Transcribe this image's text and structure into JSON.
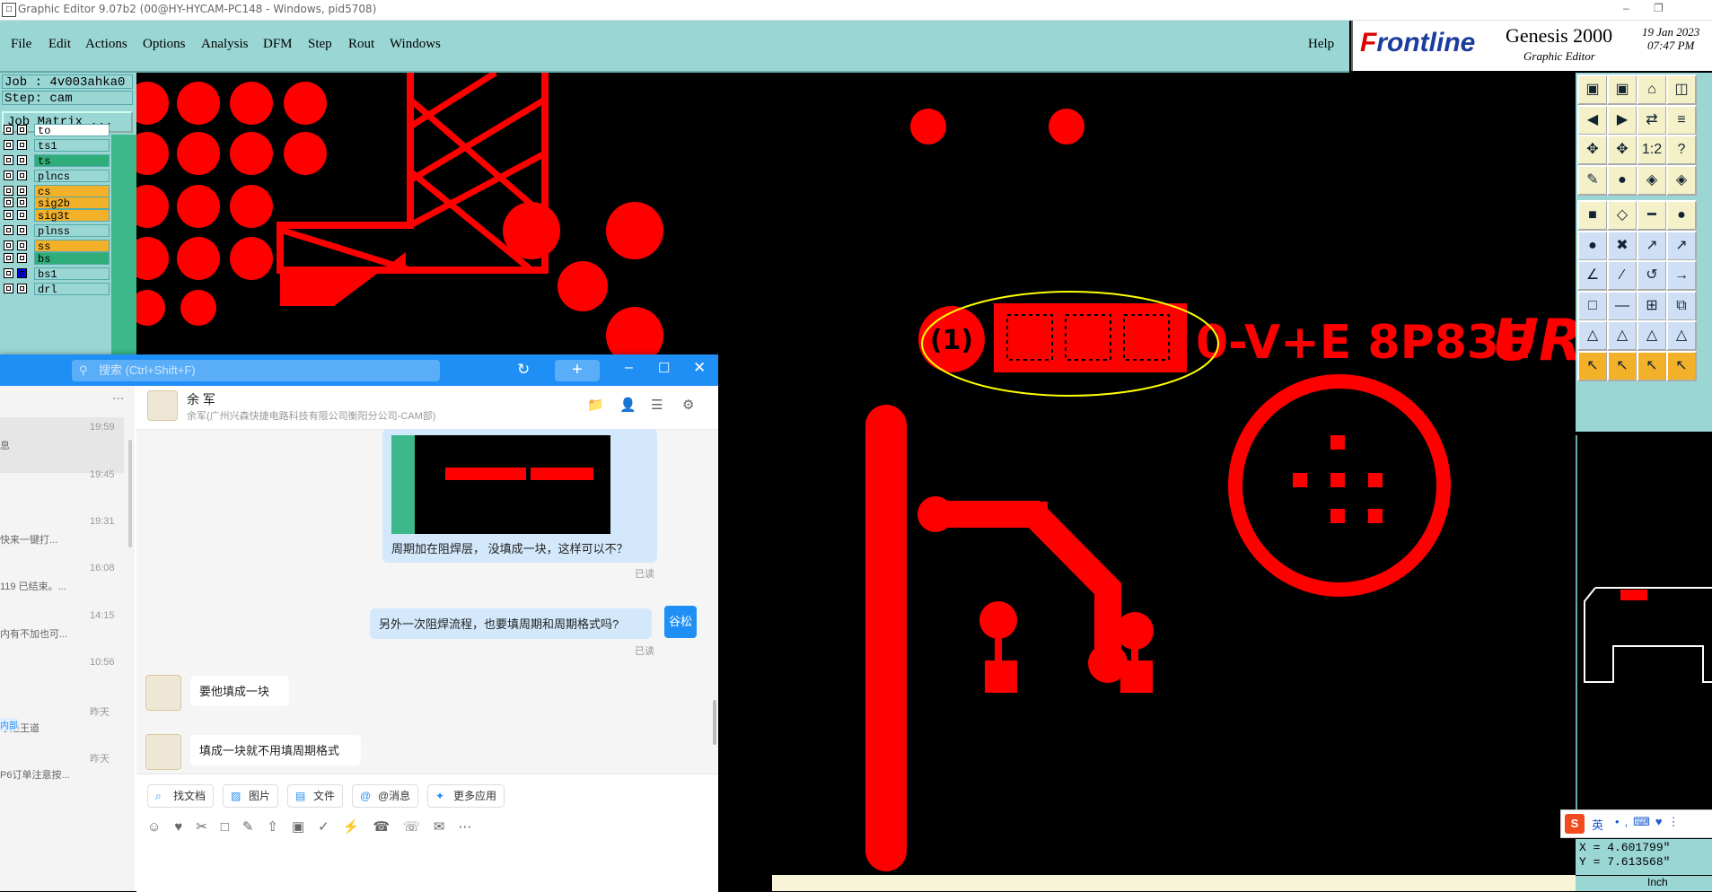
{
  "window": {
    "title": "Graphic Editor 9.07b2 (00@HY-HYCAM-PC148 - Windows, pid5708)",
    "minimize": "–",
    "restore": "❐"
  },
  "menu": [
    "File",
    "Edit",
    "Actions",
    "Options",
    "Analysis",
    "DFM",
    "Step",
    "Rout",
    "Windows"
  ],
  "help": "Help",
  "brand": {
    "logo_f": "F",
    "logo_rest": "rontline",
    "product": "Genesis 2000",
    "sub": "Graphic Editor",
    "date": "19 Jan 2023",
    "time": "07:47 PM"
  },
  "job": {
    "job_label": "Job : 4v003ahka0",
    "step_label": "Step: cam",
    "matrix_button": "Job Matrix ..."
  },
  "layers": [
    {
      "name": "to",
      "color": "#ffffff"
    },
    {
      "name": "ts1",
      "color": "#9ad6d4"
    },
    {
      "name": "ts",
      "color": "#2fae7a"
    },
    {
      "name": "plncs",
      "color": "#9ad6d4"
    },
    {
      "name": "cs",
      "color": "#f3b12a"
    },
    {
      "name": "sig2b",
      "color": "#f3b12a"
    },
    {
      "name": "sig3t",
      "color": "#f3b12a"
    },
    {
      "name": "plnss",
      "color": "#9ad6d4"
    },
    {
      "name": "ss",
      "color": "#f3b12a"
    },
    {
      "name": "bs",
      "color": "#2fae7a"
    },
    {
      "name": "bs1",
      "color": "#9ad6d4"
    },
    {
      "name": "drl",
      "color": "#9ad6d4"
    }
  ],
  "coords": {
    "x": "X = 4.601799\"",
    "y": "Y = 7.613568\""
  },
  "units": "Inch",
  "ime": {
    "logo": "S",
    "lang": "英"
  },
  "canvas_text": "0-V+E 8P83E",
  "chat": {
    "search_placeholder": "搜索 (Ctrl+Shift+F)",
    "contact_name": "余 军",
    "contact_org": "余军(广州兴森快捷电路科技有限公司衡阳分公司-CAM部)",
    "sidebar_more": "...",
    "conversations": [
      {
        "time": "19:59",
        "snippet": "息"
      },
      {
        "time": "19:45",
        "snippet": ""
      },
      {
        "time": "19:31",
        "snippet": "快来一键打..."
      },
      {
        "time": "16:08",
        "snippet": "119 已结束。..."
      },
      {
        "time": "14:15",
        "snippet": "内有不加也可..."
      },
      {
        "time": "10:56",
        "snippet": ""
      },
      {
        "time": "昨天",
        "snippet": "才是王道"
      },
      {
        "time": "昨天",
        "snippet": "P6订单注意按..."
      }
    ],
    "messages": [
      {
        "text": "周期加在阻焊层， 没填成一块，这样可以不？",
        "read": "已读"
      },
      {
        "text": "另外一次阻焊流程，也要填周期和周期格式吗?",
        "read": "已读",
        "sender": "谷松"
      },
      {
        "text": "要他填成一块"
      },
      {
        "text": "填成一块就不用填周期格式"
      }
    ],
    "quick_actions": [
      "找文档",
      "图片",
      "文件",
      "@消息",
      "更多应用"
    ],
    "sidebar_tags": [
      "内部"
    ]
  }
}
